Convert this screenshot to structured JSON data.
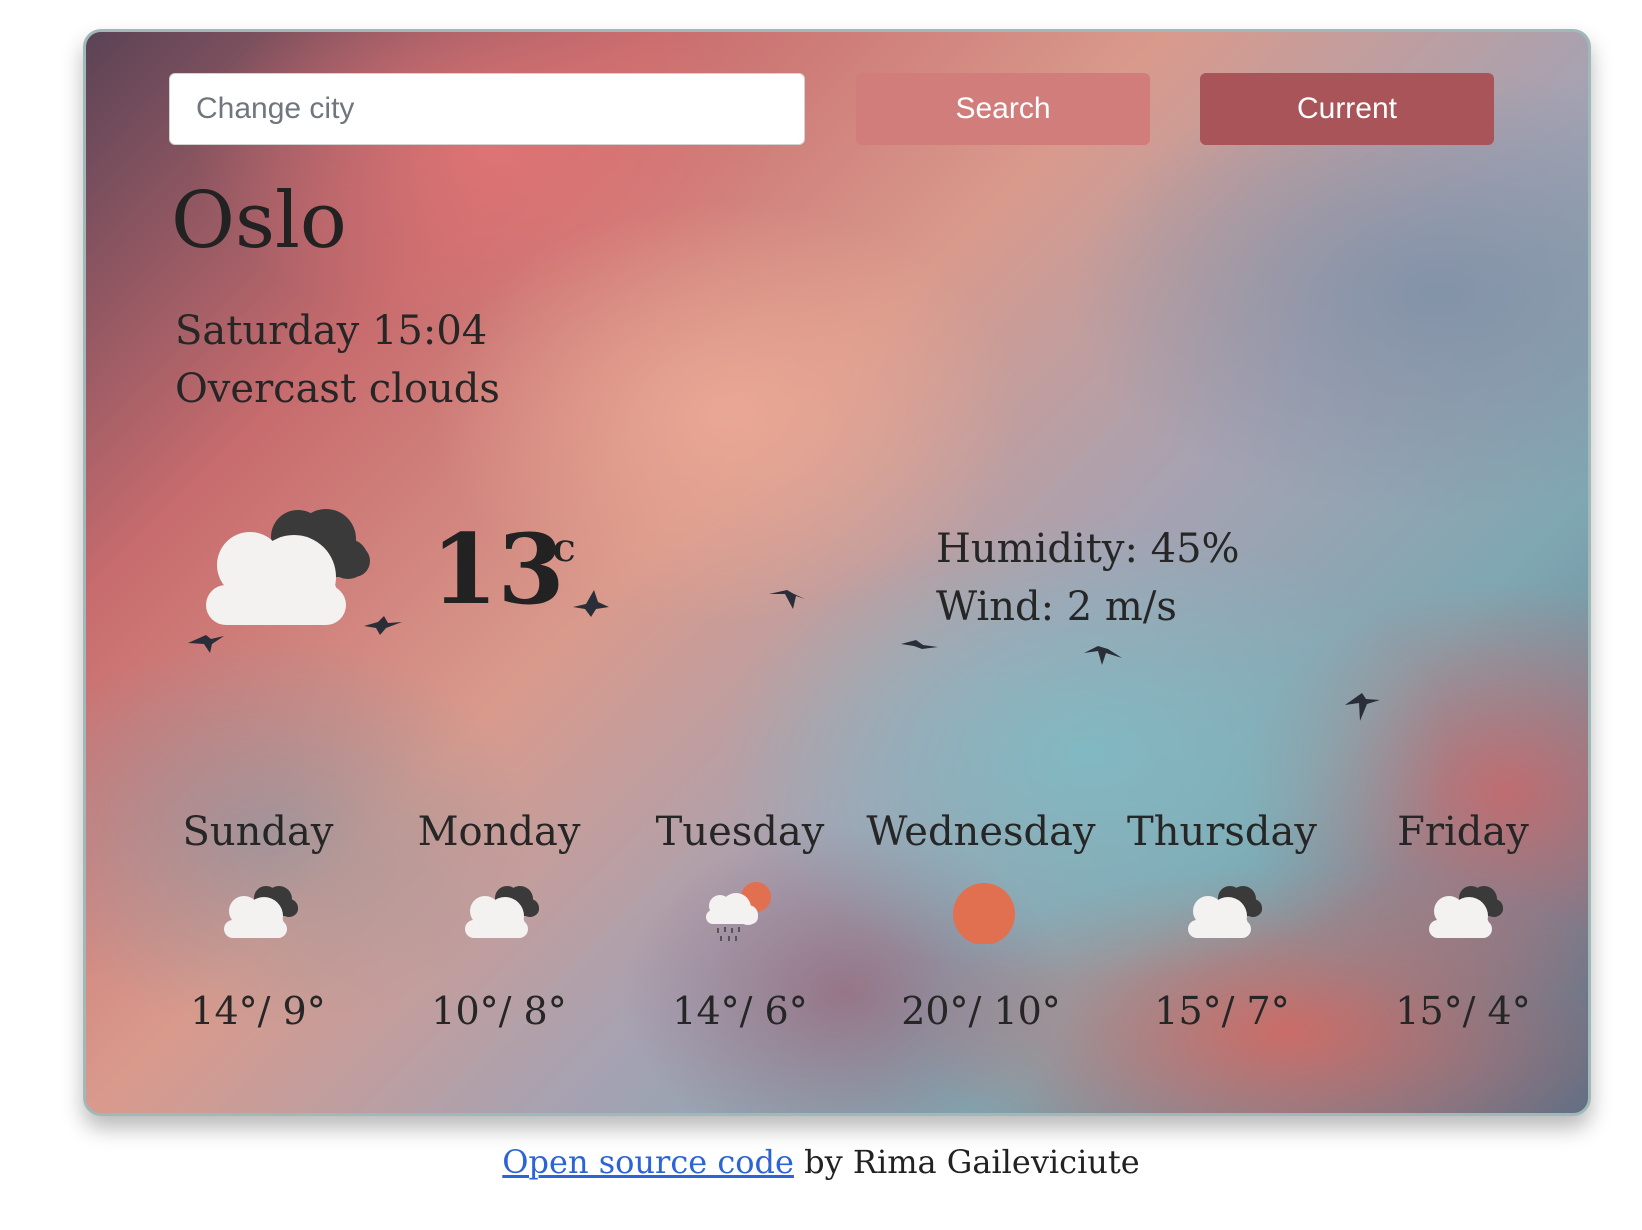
{
  "search": {
    "placeholder": "Change city",
    "search_label": "Search",
    "current_label": "Current"
  },
  "current": {
    "city": "Oslo",
    "datetime": "Saturday 15:04",
    "description": "Overcast clouds",
    "icon": "overcast-clouds-icon",
    "temperature": "13",
    "unit": "°C",
    "humidity": "Humidity: 45%",
    "wind": "Wind: 2 m/s"
  },
  "forecast": [
    {
      "day": "Sunday",
      "temps": "14°/ 9°",
      "icon": "overcast-clouds-icon"
    },
    {
      "day": "Monday",
      "temps": "10°/ 8°",
      "icon": "overcast-clouds-icon"
    },
    {
      "day": "Tuesday",
      "temps": "14°/ 6°",
      "icon": "rain-sun-icon"
    },
    {
      "day": "Wednesday",
      "temps": "20°/ 10°",
      "icon": "sun-icon"
    },
    {
      "day": "Thursday",
      "temps": "15°/ 7°",
      "icon": "overcast-clouds-icon"
    },
    {
      "day": "Friday",
      "temps": "15°/ 4°",
      "icon": "overcast-clouds-icon"
    }
  ],
  "footer": {
    "link_text": "Open source code",
    "suffix": " by Rima Gaileviciute"
  },
  "colors": {
    "search_button": "#d17d7b",
    "current_button": "#a95458",
    "sun": "#e07050",
    "link": "#2a64d6"
  }
}
